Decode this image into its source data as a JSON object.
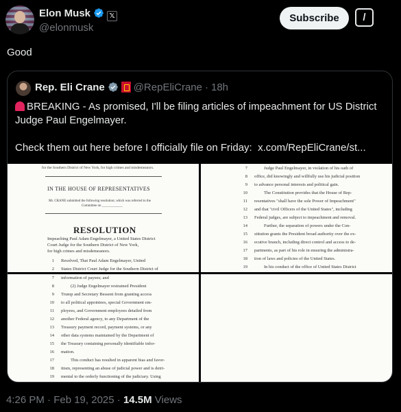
{
  "author": {
    "name": "Elon Musk",
    "handle": "@elonmusk",
    "badge_letter": "𝕏"
  },
  "header_actions": {
    "subscribe_label": "Subscribe",
    "grok_label": "/"
  },
  "tweet_text": "Good",
  "quoted": {
    "name": "Rep. Eli Crane",
    "handle": "@RepEliCrane",
    "separator": "·",
    "time": "18h",
    "line1": "BREAKING - As promised, I'll be filing articles of impeachment for US District Judge Paul Engelmayer.",
    "line2": "Check them out here before I officially file on Friday:",
    "link": "x.com/RepEliCrane/st..."
  },
  "doc1": {
    "top_line": "for the Southern District of New York, for high crimes and misdemeanors.",
    "house": "IN THE HOUSE OF REPRESENTATIVES",
    "submitted_1": "Mr. CRANE submitted the following resolution; which was referred to the",
    "submitted_2": "Committee on ____________",
    "resolution": "RESOLUTION",
    "body_1": "Impeaching Paul Adam Engelmayer, a United States District",
    "body_2": "Court Judge for the Southern District of New York,",
    "body_3": "for high crimes and misdemeanors.",
    "n1": "1",
    "l1": "Resolved, That Paul Adam Engelmayer, United",
    "n2": "2",
    "l2": "States District Court Judge for the Southern District of"
  },
  "doc2": {
    "lines": [
      {
        "n": "7",
        "t": "Judge Paul Engelmayer, in violation of his oath of"
      },
      {
        "n": "8",
        "t": "office, did knowingly and willfully use his judicial position"
      },
      {
        "n": "9",
        "t": "to advance personal interests and political gain."
      },
      {
        "n": "10",
        "t": "The Constitution provides that the House of Rep-"
      },
      {
        "n": "11",
        "t": "resentatives \"shall have the sole Power of Impeachment\""
      },
      {
        "n": "12",
        "t": "and that \"civil Officers of the United States\", including"
      },
      {
        "n": "13",
        "t": "Federal judges, are subject to impeachment and removal."
      },
      {
        "n": "14",
        "t": "Further, the separation of powers under the Con-"
      },
      {
        "n": "15",
        "t": "stitution grants the President broad authority over the ex-"
      },
      {
        "n": "16",
        "t": "ecutive branch, including direct control and access to de-"
      },
      {
        "n": "17",
        "t": "partments, as part of his role in ensuring the administra-"
      },
      {
        "n": "18",
        "t": "tion of laws and policies of the United States."
      },
      {
        "n": "19",
        "t": "In his conduct of the office of United States District"
      }
    ]
  },
  "doc3": {
    "lines": [
      {
        "n": "7",
        "t": "information of payees; and"
      },
      {
        "n": "8",
        "t": "(2) Judge Engelmayer restrained President"
      },
      {
        "n": "9",
        "t": "Trump and Secretary Bessent from granting access"
      },
      {
        "n": "10",
        "t": "to all political appointees, special Government em-"
      },
      {
        "n": "11",
        "t": "ployees, and Government employees detailed from"
      },
      {
        "n": "12",
        "t": "another Federal agency, to any Department of the"
      },
      {
        "n": "13",
        "t": "Treasury payment record, payment systems, or any"
      },
      {
        "n": "14",
        "t": "other data systems maintained by the Department of"
      },
      {
        "n": "15",
        "t": "the Treasury containing personally identifiable infor-"
      },
      {
        "n": "16",
        "t": "mation."
      },
      {
        "n": "17",
        "t": "This conduct has resulted in apparent bias and favor-"
      },
      {
        "n": "18",
        "t": "itism, representing an abuse of judicial power and is detri-"
      },
      {
        "n": "19",
        "t": "mental to the orderly functioning of the judiciary. Using"
      }
    ]
  },
  "meta": {
    "time": "4:26 PM · Feb 19, 2025 · ",
    "views_count": "14.5M",
    "views_label": " Views"
  },
  "colors": {
    "background": "#000000",
    "text": "#e7e9ea",
    "muted": "#71767b",
    "verified_blue": "#1d9bf0",
    "border": "#2f3336"
  }
}
